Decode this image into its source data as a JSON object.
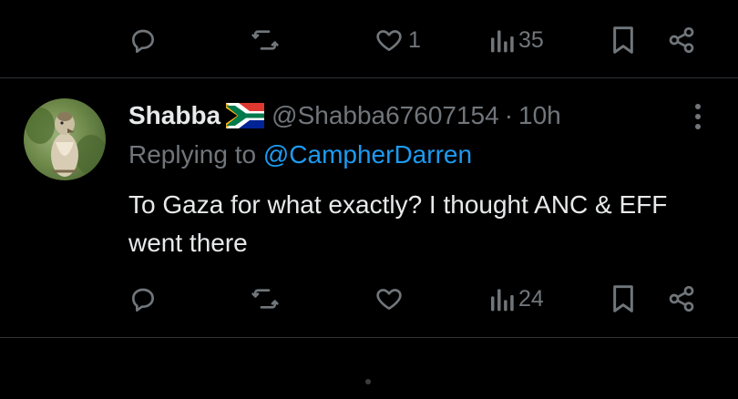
{
  "top_actions": {
    "replies": "",
    "reposts": "",
    "likes": "1",
    "views": "35"
  },
  "tweet": {
    "author": {
      "display_name": "Shabba",
      "handle": "@Shabba67607154",
      "separator": "·",
      "time": "10h"
    },
    "replying_prefix": "Replying to ",
    "replying_to": "@CampherDarren",
    "text": "To Gaza for what exactly? I thought ANC & EFF went there",
    "actions": {
      "replies": "",
      "reposts": "",
      "likes": "",
      "views": "24"
    }
  },
  "icons": [
    "reply-icon",
    "repost-icon",
    "like-icon",
    "views-icon",
    "bookmark-icon",
    "share-icon",
    "more-icon",
    "south-africa-flag-icon"
  ],
  "colors": {
    "background": "#000000",
    "text": "#e7e9ea",
    "muted": "#71767b",
    "link": "#1d9bf0",
    "divider": "#2f3336"
  }
}
